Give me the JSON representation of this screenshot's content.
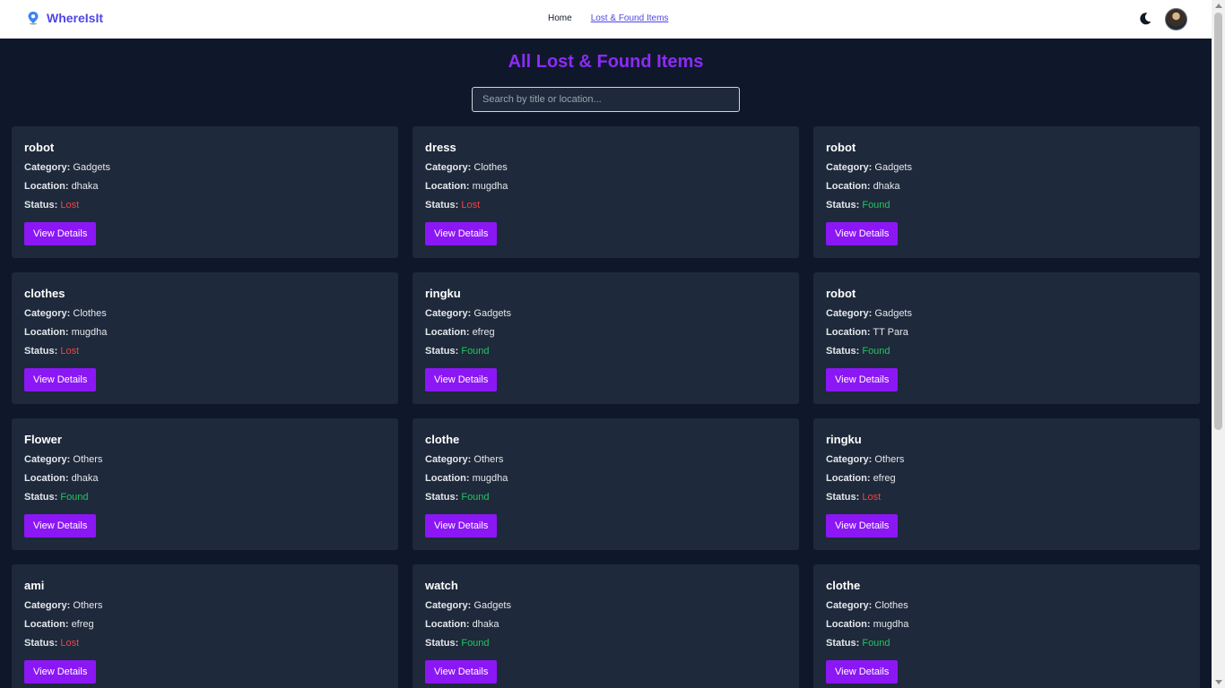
{
  "nav": {
    "brand": "WhereIsIt",
    "links": [
      {
        "label": "Home",
        "active": false
      },
      {
        "label": "Lost & Found Items",
        "active": true
      }
    ],
    "theme_toggle_icon": "moon-icon",
    "avatar_icon": "user-avatar"
  },
  "main": {
    "title": "All Lost & Found Items",
    "search_placeholder": "Search by title or location..."
  },
  "labels": {
    "category": "Category:",
    "location": "Location:",
    "status": "Status:",
    "button": "View Details"
  },
  "colors": {
    "accent": "#8b17f5",
    "lost": "#ef4444",
    "found": "#22c55e",
    "card_bg": "#1e293b",
    "page_bg": "#0f172a"
  },
  "items": [
    {
      "title": "robot",
      "category": "Gadgets",
      "location": "dhaka",
      "status": "Lost"
    },
    {
      "title": "dress",
      "category": "Clothes",
      "location": "mugdha",
      "status": "Lost"
    },
    {
      "title": "robot",
      "category": "Gadgets",
      "location": "dhaka",
      "status": "Found"
    },
    {
      "title": "clothes",
      "category": "Clothes",
      "location": "mugdha",
      "status": "Lost"
    },
    {
      "title": "ringku",
      "category": "Gadgets",
      "location": "efreg",
      "status": "Found"
    },
    {
      "title": "robot",
      "category": "Gadgets",
      "location": "TT Para",
      "status": "Found"
    },
    {
      "title": "Flower",
      "category": "Others",
      "location": "dhaka",
      "status": "Found"
    },
    {
      "title": "clothe",
      "category": "Others",
      "location": "mugdha",
      "status": "Found"
    },
    {
      "title": "ringku",
      "category": "Others",
      "location": "efreg",
      "status": "Lost"
    },
    {
      "title": "ami",
      "category": "Others",
      "location": "efreg",
      "status": "Lost"
    },
    {
      "title": "watch",
      "category": "Gadgets",
      "location": "dhaka",
      "status": "Found"
    },
    {
      "title": "clothe",
      "category": "Clothes",
      "location": "mugdha",
      "status": "Found"
    }
  ]
}
